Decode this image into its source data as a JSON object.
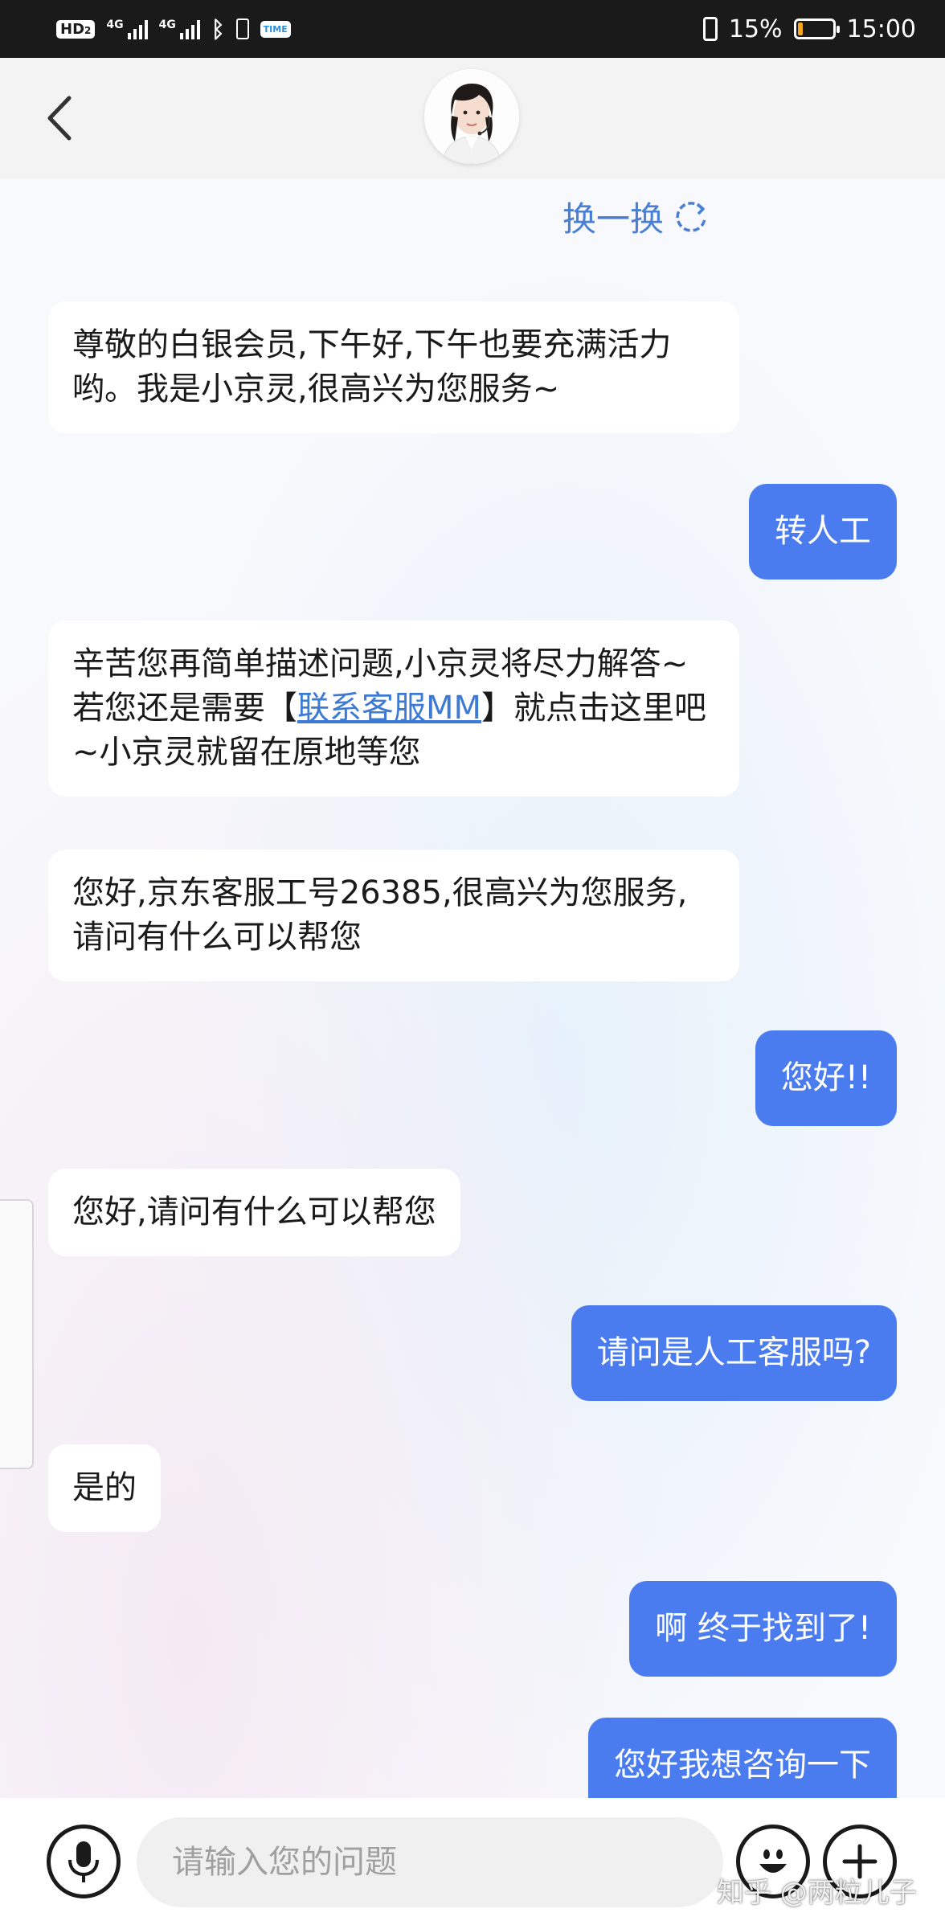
{
  "status_bar": {
    "hd_label": "HD",
    "hd_sub": "2",
    "network_1": "4G",
    "network_2": "4G",
    "battery_percent": "15%",
    "battery_level": 0.15,
    "time": "15:00",
    "icons": [
      "hd-icon",
      "signal-icon",
      "signal-icon",
      "bluetooth-icon",
      "app-notification-icon",
      "vibrate-icon",
      "battery-icon"
    ]
  },
  "header": {
    "back_icon": "chevron-left-icon",
    "avatar_icon": "agent-avatar-icon"
  },
  "chat": {
    "switch_label": "换一换",
    "switch_icon": "refresh-icon",
    "messages": [
      {
        "sender": "bot",
        "text": "尊敬的白银会员,下午好,下午也要充满活力哟。我是小京灵,很高兴为您服务~"
      },
      {
        "sender": "user",
        "text": "转人工"
      },
      {
        "sender": "bot",
        "text_before": "辛苦您再简单描述问题,小京灵将尽力解答~若您还是需要【",
        "link": "联系客服MM",
        "text_after": "】就点击这里吧~小京灵就留在原地等您"
      },
      {
        "sender": "bot",
        "text": "您好,京东客服工号26385,很高兴为您服务,请问有什么可以帮您"
      },
      {
        "sender": "user",
        "text": "您好!!"
      },
      {
        "sender": "bot",
        "text": "您好,请问有什么可以帮您"
      },
      {
        "sender": "user",
        "text": "请问是人工客服吗?"
      },
      {
        "sender": "bot",
        "text": "是的"
      },
      {
        "sender": "user",
        "text": "啊 终于找到了!"
      },
      {
        "sender": "user",
        "text": "您好我想咨询一下"
      }
    ]
  },
  "input_bar": {
    "voice_icon": "microphone-icon",
    "placeholder": "请输入您的问题",
    "emoji_icon": "emoji-icon",
    "plus_icon": "plus-icon"
  },
  "watermark": "知乎 @两粒儿子",
  "colors": {
    "accent": "#4a7cf0",
    "link": "#3d7ad6",
    "status_bar": "#1a1a1a",
    "battery": "#f5a623"
  }
}
